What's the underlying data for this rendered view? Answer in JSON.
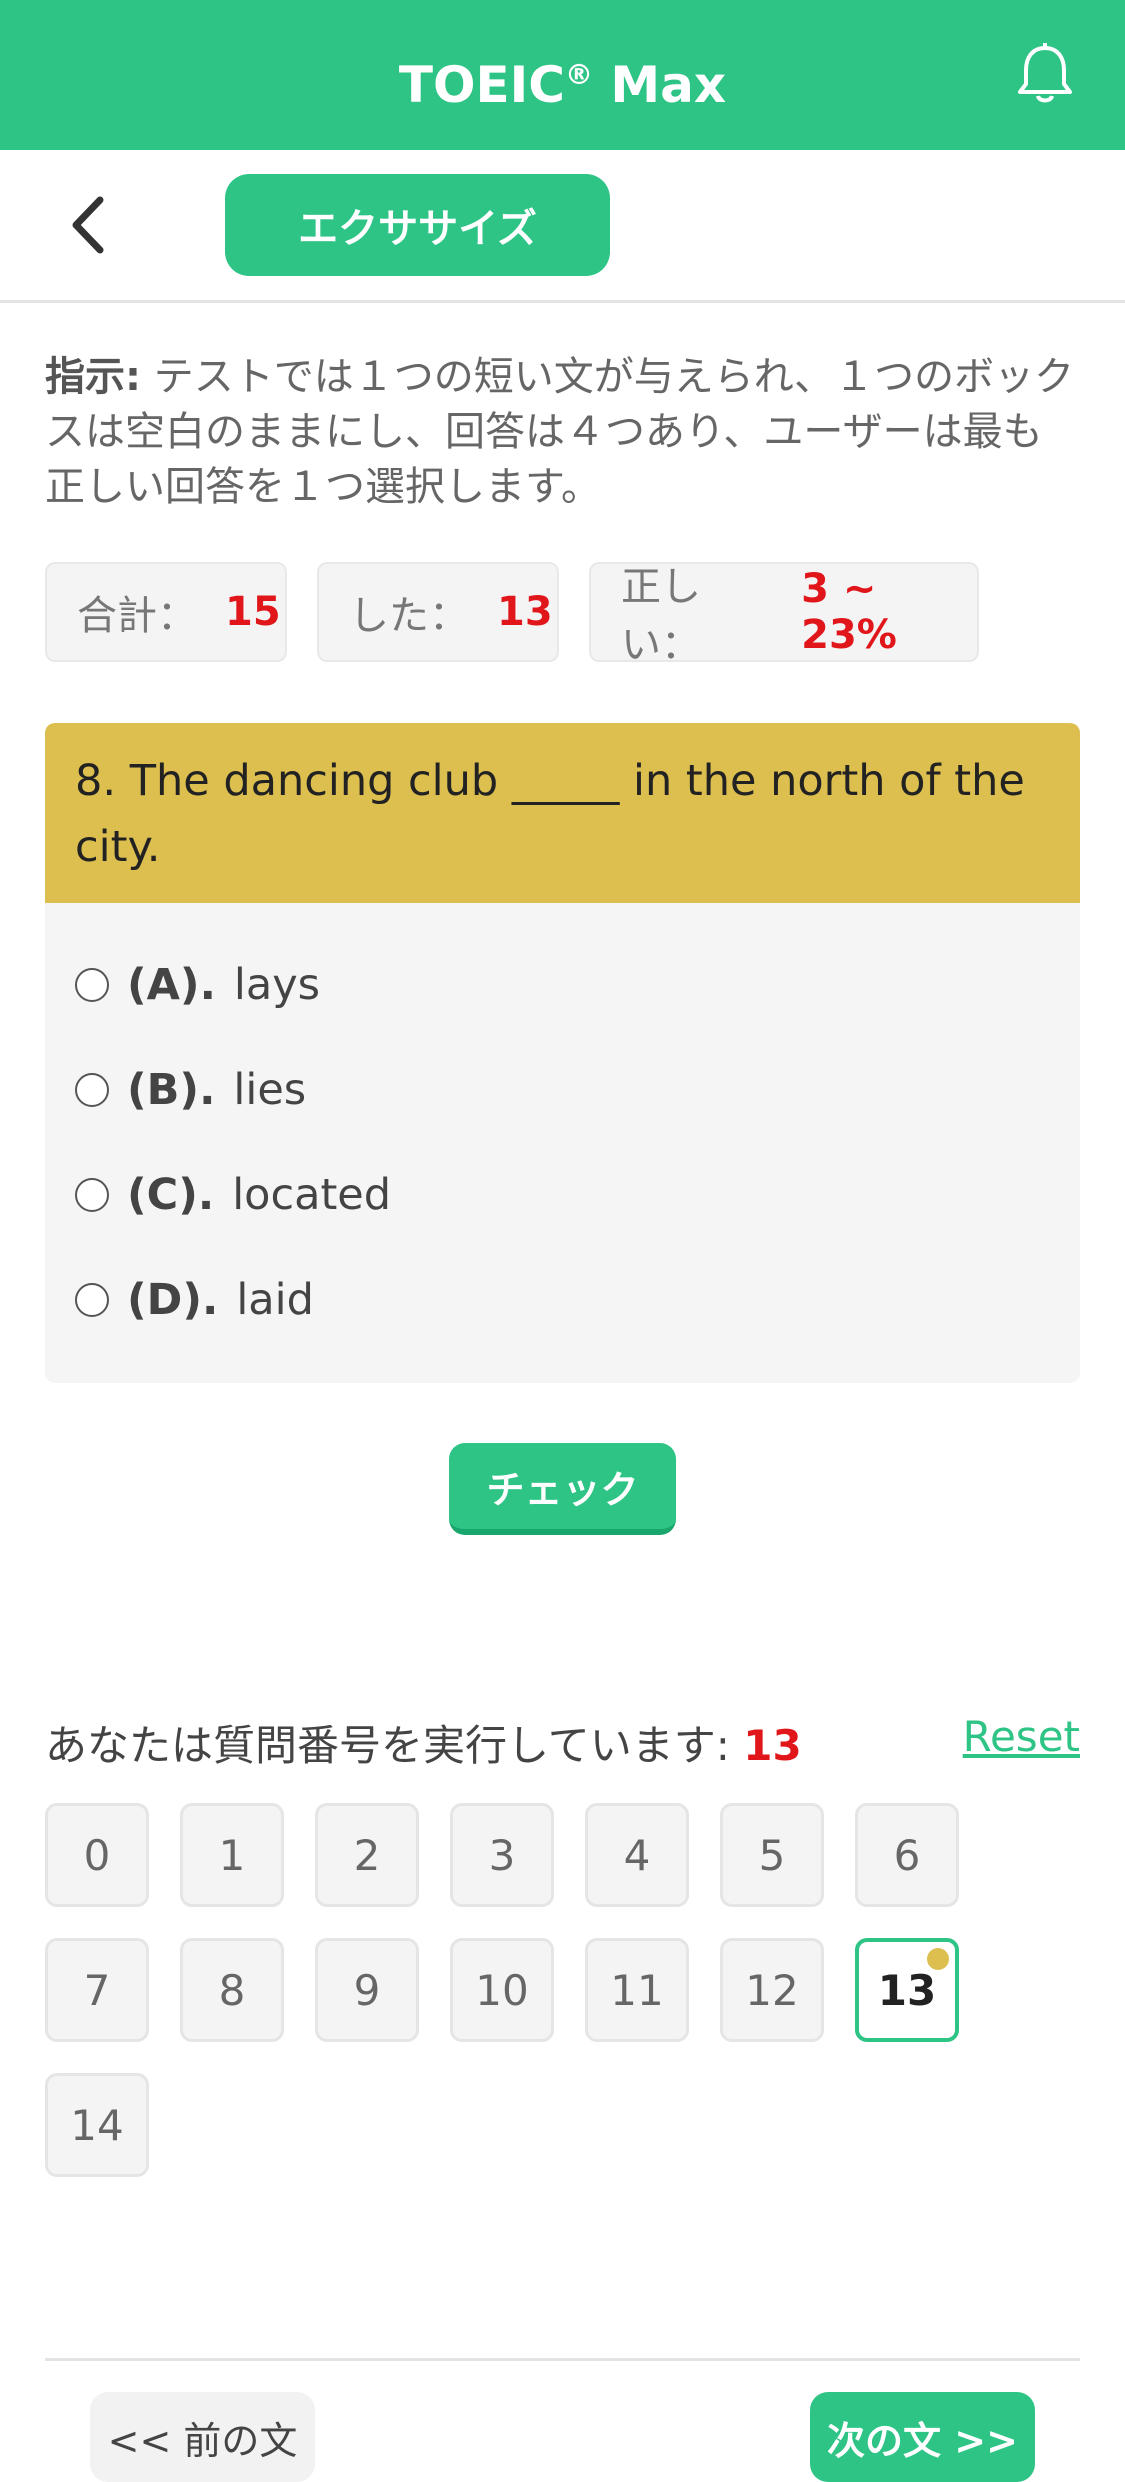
{
  "header": {
    "title_main": "TOEIC",
    "title_reg": "®",
    "title_tail": " Max",
    "bell_icon": "bell-icon"
  },
  "subbar": {
    "back_icon": "chevron-left-icon",
    "tab_label": "エクササイズ"
  },
  "instructions": {
    "label": "指示:",
    "text": " テストでは１つの短い文が与えられ、１つのボックスは空白のままにし、回答は４つあり、ユーザーは最も正しい回答を１つ選択します。"
  },
  "stats": {
    "total_label": "合計：",
    "total_value": "15",
    "done_label": "した：",
    "done_value": "13",
    "correct_label": "正しい：",
    "correct_value": "3 ~ 23%"
  },
  "question": {
    "text": "8. The dancing club _____ in the north of the city.",
    "options": [
      {
        "letter": "(A).",
        "text": "lays"
      },
      {
        "letter": "(B).",
        "text": "lies"
      },
      {
        "letter": "(C).",
        "text": "located"
      },
      {
        "letter": "(D).",
        "text": "laid"
      }
    ]
  },
  "check_label": "チェック",
  "progress": {
    "label": "あなたは質問番号を実行しています:",
    "current": "13",
    "reset": "Reset"
  },
  "numbers": [
    "0",
    "1",
    "2",
    "3",
    "4",
    "5",
    "6",
    "7",
    "8",
    "9",
    "10",
    "11",
    "12",
    "13",
    "14"
  ],
  "nav": {
    "prev": "<< 前の文",
    "next": "次の文 >>"
  },
  "colors": {
    "accent": "#2ec486",
    "question_bg": "#dcbf4f",
    "highlight": "#e0161b"
  }
}
